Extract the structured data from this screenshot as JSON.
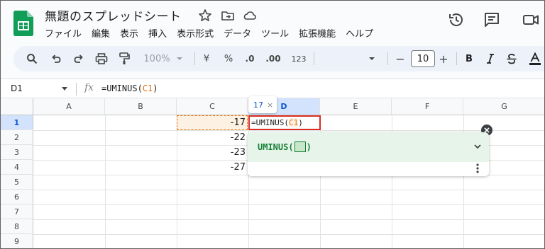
{
  "document": {
    "title": "無題のスプレッドシート"
  },
  "menu": [
    "ファイル",
    "編集",
    "表示",
    "挿入",
    "表示形式",
    "データ",
    "ツール",
    "拡張機能",
    "ヘルプ"
  ],
  "toolbar": {
    "zoom": "100%",
    "currency": "¥",
    "percent": "%",
    "decrease_decimal": ".0",
    "increase_decimal": ".00",
    "number_format": "123",
    "font_size": "10",
    "minus": "−",
    "plus": "+",
    "bold": "B"
  },
  "formula_bar": {
    "name_box": "D1",
    "fx": "fx",
    "formula_prefix": "=UMINUS(",
    "formula_ref": "C1",
    "formula_suffix": ")"
  },
  "grid": {
    "columns": [
      "A",
      "B",
      "C",
      "D",
      "E",
      "F",
      "G"
    ],
    "rows": [
      "1",
      "2",
      "3",
      "4",
      "5",
      "6",
      "7",
      "8",
      "9"
    ],
    "selected_column": "D",
    "selected_row": "1",
    "cells": {
      "C1": "-17",
      "C2": "-22",
      "C3": "-23",
      "C4": "-27"
    },
    "d1_edit_prefix": "=UMINUS(",
    "d1_edit_ref": "C1",
    "d1_edit_suffix": ")"
  },
  "value_tooltip": {
    "value": "17",
    "close": "×"
  },
  "function_help": {
    "name": "UMINUS",
    "open_paren": "(",
    "close_paren": ")"
  },
  "colors": {
    "accent": "#0b57d0",
    "ref_orange": "#e8710a",
    "edit_border": "#d93025",
    "help_green": "#188038",
    "sheets_green": "#0f9d58"
  }
}
